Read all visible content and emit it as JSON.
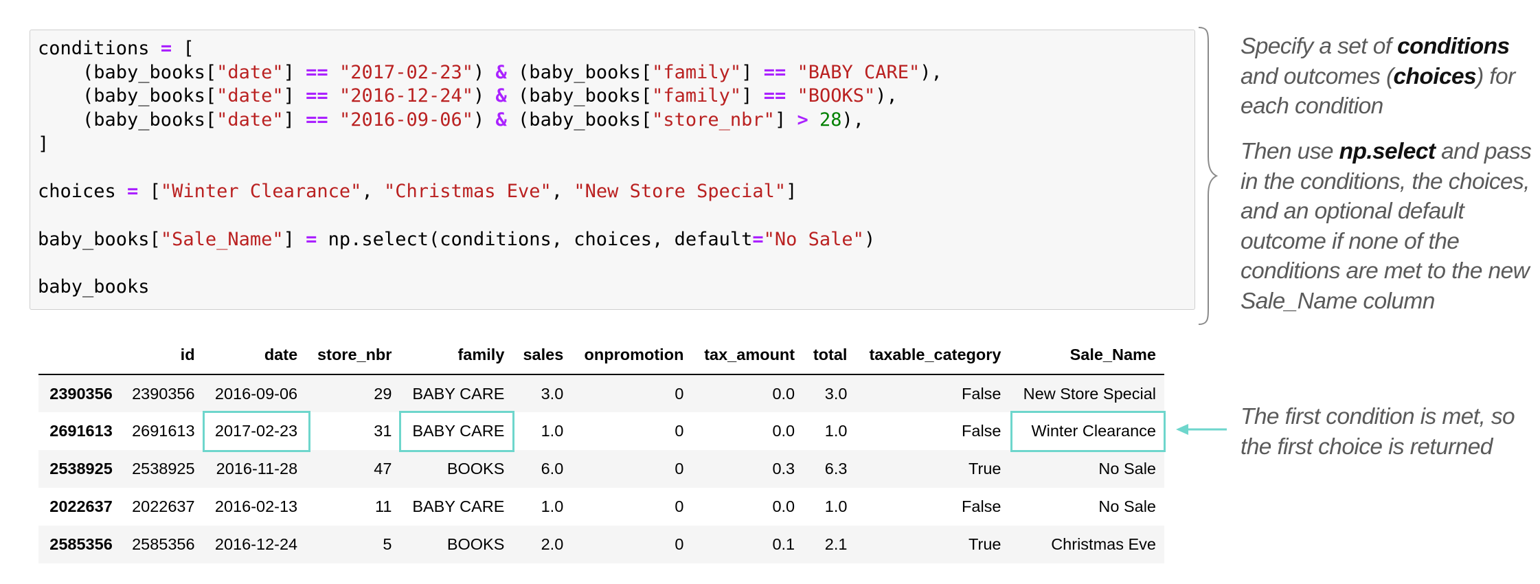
{
  "code": {
    "lines": [
      [
        {
          "t": "txt",
          "v": "conditions "
        },
        {
          "t": "op",
          "v": "="
        },
        {
          "t": "txt",
          "v": " ["
        }
      ],
      [
        {
          "t": "txt",
          "v": "    (baby_books["
        },
        {
          "t": "str",
          "v": "\"date\""
        },
        {
          "t": "txt",
          "v": "] "
        },
        {
          "t": "op",
          "v": "=="
        },
        {
          "t": "txt",
          "v": " "
        },
        {
          "t": "str",
          "v": "\"2017-02-23\""
        },
        {
          "t": "txt",
          "v": ") "
        },
        {
          "t": "op",
          "v": "&"
        },
        {
          "t": "txt",
          "v": " (baby_books["
        },
        {
          "t": "str",
          "v": "\"family\""
        },
        {
          "t": "txt",
          "v": "] "
        },
        {
          "t": "op",
          "v": "=="
        },
        {
          "t": "txt",
          "v": " "
        },
        {
          "t": "str",
          "v": "\"BABY CARE\""
        },
        {
          "t": "txt",
          "v": "),"
        }
      ],
      [
        {
          "t": "txt",
          "v": "    (baby_books["
        },
        {
          "t": "str",
          "v": "\"date\""
        },
        {
          "t": "txt",
          "v": "] "
        },
        {
          "t": "op",
          "v": "=="
        },
        {
          "t": "txt",
          "v": " "
        },
        {
          "t": "str",
          "v": "\"2016-12-24\""
        },
        {
          "t": "txt",
          "v": ") "
        },
        {
          "t": "op",
          "v": "&"
        },
        {
          "t": "txt",
          "v": " (baby_books["
        },
        {
          "t": "str",
          "v": "\"family\""
        },
        {
          "t": "txt",
          "v": "] "
        },
        {
          "t": "op",
          "v": "=="
        },
        {
          "t": "txt",
          "v": " "
        },
        {
          "t": "str",
          "v": "\"BOOKS\""
        },
        {
          "t": "txt",
          "v": "),"
        }
      ],
      [
        {
          "t": "txt",
          "v": "    (baby_books["
        },
        {
          "t": "str",
          "v": "\"date\""
        },
        {
          "t": "txt",
          "v": "] "
        },
        {
          "t": "op",
          "v": "=="
        },
        {
          "t": "txt",
          "v": " "
        },
        {
          "t": "str",
          "v": "\"2016-09-06\""
        },
        {
          "t": "txt",
          "v": ") "
        },
        {
          "t": "op",
          "v": "&"
        },
        {
          "t": "txt",
          "v": " (baby_books["
        },
        {
          "t": "str",
          "v": "\"store_nbr\""
        },
        {
          "t": "txt",
          "v": "] "
        },
        {
          "t": "op",
          "v": ">"
        },
        {
          "t": "txt",
          "v": " "
        },
        {
          "t": "num",
          "v": "28"
        },
        {
          "t": "txt",
          "v": "),"
        }
      ],
      [
        {
          "t": "txt",
          "v": "]"
        }
      ],
      [],
      [
        {
          "t": "txt",
          "v": "choices "
        },
        {
          "t": "op",
          "v": "="
        },
        {
          "t": "txt",
          "v": " ["
        },
        {
          "t": "str",
          "v": "\"Winter Clearance\""
        },
        {
          "t": "txt",
          "v": ", "
        },
        {
          "t": "str",
          "v": "\"Christmas Eve\""
        },
        {
          "t": "txt",
          "v": ", "
        },
        {
          "t": "str",
          "v": "\"New Store Special\""
        },
        {
          "t": "txt",
          "v": "]"
        }
      ],
      [],
      [
        {
          "t": "txt",
          "v": "baby_books["
        },
        {
          "t": "str",
          "v": "\"Sale_Name\""
        },
        {
          "t": "txt",
          "v": "] "
        },
        {
          "t": "op",
          "v": "="
        },
        {
          "t": "txt",
          "v": " np.select(conditions, choices, default"
        },
        {
          "t": "op",
          "v": "="
        },
        {
          "t": "str",
          "v": "\"No Sale\""
        },
        {
          "t": "txt",
          "v": ")"
        }
      ],
      [],
      [
        {
          "t": "txt",
          "v": "baby_books"
        }
      ]
    ]
  },
  "annotations": {
    "top": {
      "a": "Specify a set of ",
      "b1": "conditions",
      "c": " and outcomes (",
      "b2": "choices",
      "d": ") for each condition"
    },
    "middle": {
      "a": "Then use ",
      "b": "np.select",
      "c": " and pass in the conditions, the choices, and an optional default outcome if none of the conditions are met to the new Sale_Name column"
    },
    "bottom": "The first condition is met, so the first choice is returned"
  },
  "table": {
    "columns": [
      "",
      "id",
      "date",
      "store_nbr",
      "family",
      "sales",
      "onpromotion",
      "tax_amount",
      "total",
      "taxable_category",
      "Sale_Name"
    ],
    "rows": [
      [
        "2390356",
        "2390356",
        "2016-09-06",
        "29",
        "BABY CARE",
        "3.0",
        "0",
        "0.0",
        "3.0",
        "False",
        "New Store Special"
      ],
      [
        "2691613",
        "2691613",
        "2017-02-23",
        "31",
        "BABY CARE",
        "1.0",
        "0",
        "0.0",
        "1.0",
        "False",
        "Winter Clearance"
      ],
      [
        "2538925",
        "2538925",
        "2016-11-28",
        "47",
        "BOOKS",
        "6.0",
        "0",
        "0.3",
        "6.3",
        "True",
        "No Sale"
      ],
      [
        "2022637",
        "2022637",
        "2016-02-13",
        "11",
        "BABY CARE",
        "1.0",
        "0",
        "0.0",
        "1.0",
        "False",
        "No Sale"
      ],
      [
        "2585356",
        "2585356",
        "2016-12-24",
        "5",
        "BOOKS",
        "2.0",
        "0",
        "0.1",
        "2.1",
        "True",
        "Christmas Eve"
      ]
    ]
  },
  "colors": {
    "highlight": "#6ed6cc",
    "string": "#ba2121",
    "operator": "#aa22ff",
    "number": "#008000",
    "annotation": "#5a5a5a"
  }
}
